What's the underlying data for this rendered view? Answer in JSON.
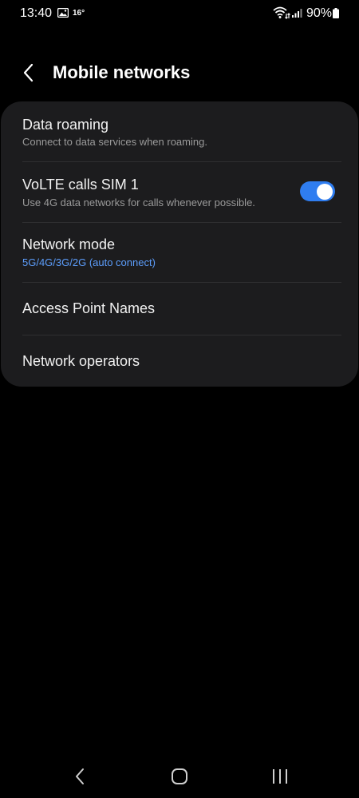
{
  "status_bar": {
    "time": "13:40",
    "temperature": "16°",
    "battery": "90%",
    "icons": [
      "gallery-icon",
      "wifi-icon",
      "signal-icon",
      "battery-icon"
    ]
  },
  "header": {
    "title": "Mobile networks",
    "back_icon": "back-icon"
  },
  "items": [
    {
      "title": "Data roaming",
      "subtitle": "Connect to data services when roaming."
    },
    {
      "title": "VoLTE calls SIM 1",
      "subtitle": "Use 4G data networks for calls whenever possible.",
      "toggle_on": true
    },
    {
      "title": "Network mode",
      "subtitle": "5G/4G/3G/2G (auto connect)"
    },
    {
      "title": "Access Point Names"
    },
    {
      "title": "Network operators"
    }
  ],
  "colors": {
    "background": "#000000",
    "card": "#1c1c1e",
    "accent": "#2f7df0",
    "accent_text": "#5c9dfb",
    "subtitle": "#9a9a9a"
  },
  "nav_bar": {
    "icons": [
      "nav-back-icon",
      "nav-home-icon",
      "nav-recents-icon"
    ]
  }
}
